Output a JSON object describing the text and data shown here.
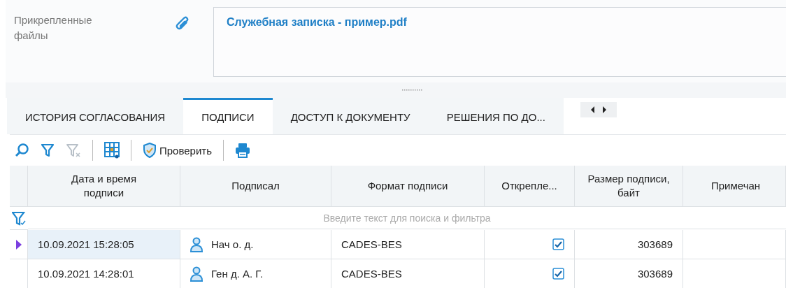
{
  "attachments": {
    "label": "Прикрепленные файлы",
    "files": [
      "Служебная записка - пример.pdf"
    ]
  },
  "tabs": [
    {
      "label": "ИСТОРИЯ СОГЛАСОВАНИЯ",
      "selected": false
    },
    {
      "label": "ПОДПИСИ",
      "selected": true
    },
    {
      "label": "ДОСТУП К ДОКУМЕНТУ",
      "selected": false
    },
    {
      "label": "РЕШЕНИЯ ПО ДО...",
      "selected": false
    }
  ],
  "toolbar": [
    {
      "kind": "search",
      "disabled": false
    },
    {
      "kind": "filter",
      "disabled": false
    },
    {
      "kind": "clear_filter",
      "disabled": true
    },
    {
      "kind": "separator"
    },
    {
      "kind": "columns",
      "disabled": false
    },
    {
      "kind": "separator"
    },
    {
      "kind": "verify",
      "label": "Проверить",
      "disabled": false
    },
    {
      "kind": "separator"
    },
    {
      "kind": "print",
      "disabled": false
    }
  ],
  "table": {
    "columns": [
      "Дата и время подписи",
      "Подписал",
      "Формат подписи",
      "Открепле...",
      "Размер подписи, байт",
      "Примечан"
    ],
    "filter_placeholder": "Введите текст для поиска и фильтра",
    "rows": [
      {
        "selected": true,
        "date": "10.09.2021 15:28:05",
        "signer": "Нач о. д.",
        "format": "CADES-BES",
        "detached": true,
        "size": "303689"
      },
      {
        "selected": false,
        "date": "10.09.2021 14:28:01",
        "signer": "Ген д. А. Г.",
        "format": "CADES-BES",
        "detached": true,
        "size": "303689"
      }
    ]
  }
}
